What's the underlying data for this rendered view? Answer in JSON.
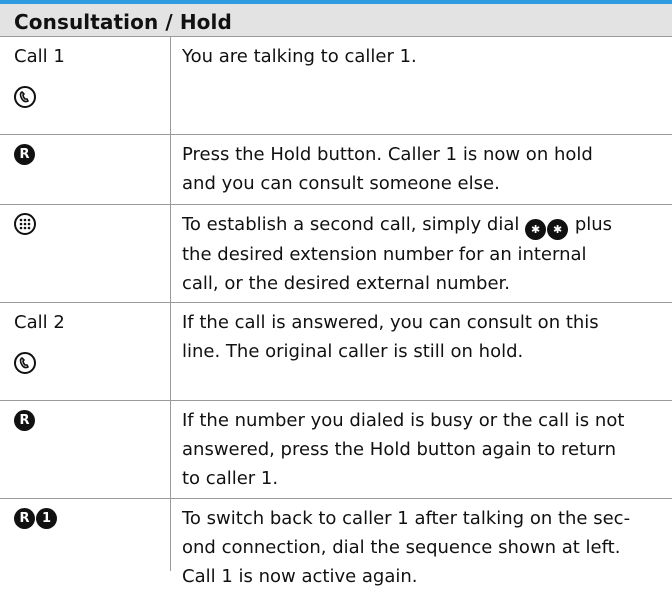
{
  "header": {
    "title": "Consultation / Hold"
  },
  "rows": [
    {
      "label": "Call 1",
      "icon": "handset-icon",
      "text": "You are talking to caller 1."
    },
    {
      "icon": "r-key-icon",
      "line1": "Press the Hold button. Caller 1 is now on hold",
      "line2": "and you can consult someone else."
    },
    {
      "icon": "keypad-icon",
      "line1_prefix": "To establish a second call, simply dial",
      "line1_suffix": "plus",
      "line2": "the desired extension number for an internal",
      "line3": "call, or the desired external number."
    },
    {
      "label": "Call 2",
      "icon": "handset-icon",
      "line1": "If the call is answered, you can consult on this",
      "line2": "line. The original caller is still on hold."
    },
    {
      "icon": "r-key-icon",
      "line1": "If the number you dialed is busy or the call is not",
      "line2": "answered, press the Hold button again to return",
      "line3": "to caller 1."
    },
    {
      "icon": "r-key-and-1-key-icon",
      "line1": "To switch back to caller 1 after talking on the sec-",
      "line2": "ond connection, dial the sequence shown at left.",
      "line3": "Call 1 is now active again."
    }
  ],
  "icons": {
    "r_key_glyph": "R",
    "one_key_glyph": "1",
    "star_key_glyph": "✱",
    "keypad_glyph": "⠿"
  },
  "colors": {
    "header_bg": "#e3e3e3",
    "header_accent": "#2f9be0",
    "rule": "#9a9a9a"
  }
}
